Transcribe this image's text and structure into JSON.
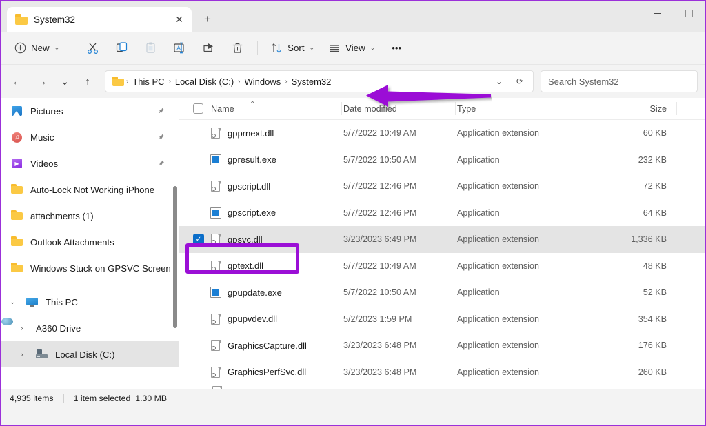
{
  "window": {
    "controls": {
      "minimize": "—",
      "maximize": "□"
    }
  },
  "tabbar": {
    "active_tab": "System32",
    "close_label": "✕",
    "new_tab_label": "+"
  },
  "toolbar": {
    "new_label": "New",
    "new_chevron": "⌄",
    "sort_label": "Sort",
    "sort_chevron": "⌄",
    "view_label": "View",
    "view_chevron": "⌄",
    "more_label": "•••"
  },
  "addressbar": {
    "back": "←",
    "forward": "→",
    "recent_chevron": "⌄",
    "up": "↑",
    "crumbs": [
      "This PC",
      "Local Disk (C:)",
      "Windows",
      "System32"
    ],
    "separator": "›",
    "dropdown_chevron": "⌄",
    "refresh": "⟳",
    "search_placeholder": "Search System32"
  },
  "sidebar": {
    "items": [
      {
        "label": "Pictures",
        "icon": "pictures-icon",
        "pinned": true,
        "indent": 1
      },
      {
        "label": "Music",
        "icon": "music-icon",
        "pinned": true,
        "indent": 1
      },
      {
        "label": "Videos",
        "icon": "videos-icon",
        "pinned": true,
        "indent": 1
      },
      {
        "label": "Auto-Lock Not Working iPhone",
        "icon": "folder-icon",
        "pinned": false,
        "indent": 1
      },
      {
        "label": "attachments (1)",
        "icon": "folder-icon",
        "pinned": false,
        "indent": 1
      },
      {
        "label": "Outlook Attachments",
        "icon": "folder-icon",
        "pinned": false,
        "indent": 1
      },
      {
        "label": "Windows Stuck on GPSVC Screen",
        "icon": "folder-icon",
        "pinned": false,
        "indent": 1
      }
    ],
    "tree": [
      {
        "label": "This PC",
        "icon": "pc-icon",
        "expander": "⌄",
        "selected": false
      },
      {
        "label": "A360 Drive",
        "icon": "drive-icon",
        "expander": "›",
        "selected": false
      },
      {
        "label": "Local Disk (C:)",
        "icon": "disk-icon",
        "expander": "›",
        "selected": true
      }
    ],
    "pin_glyph": "📌"
  },
  "filelist": {
    "columns": [
      "Name",
      "Date modified",
      "Type",
      "Size"
    ],
    "sort_caret": "⌃",
    "check_glyph": "✓",
    "rows": [
      {
        "name": "gpprnext.dll",
        "date": "5/7/2022 10:49 AM",
        "type": "Application extension",
        "size": "60 KB",
        "icon": "dll-file-icon",
        "selected": false
      },
      {
        "name": "gpresult.exe",
        "date": "5/7/2022 10:50 AM",
        "type": "Application",
        "size": "232 KB",
        "icon": "exe-file-icon",
        "selected": false
      },
      {
        "name": "gpscript.dll",
        "date": "5/7/2022 12:46 PM",
        "type": "Application extension",
        "size": "72 KB",
        "icon": "dll-file-icon",
        "selected": false
      },
      {
        "name": "gpscript.exe",
        "date": "5/7/2022 12:46 PM",
        "type": "Application",
        "size": "64 KB",
        "icon": "exe-file-icon",
        "selected": false
      },
      {
        "name": "gpsvc.dll",
        "date": "3/23/2023 6:49 PM",
        "type": "Application extension",
        "size": "1,336 KB",
        "icon": "dll-file-icon",
        "selected": true
      },
      {
        "name": "gptext.dll",
        "date": "5/7/2022 10:49 AM",
        "type": "Application extension",
        "size": "48 KB",
        "icon": "dll-file-icon",
        "selected": false
      },
      {
        "name": "gpupdate.exe",
        "date": "5/7/2022 10:50 AM",
        "type": "Application",
        "size": "52 KB",
        "icon": "exe-file-icon",
        "selected": false
      },
      {
        "name": "gpupvdev.dll",
        "date": "5/2/2023 1:59 PM",
        "type": "Application extension",
        "size": "354 KB",
        "icon": "dll-file-icon",
        "selected": false
      },
      {
        "name": "GraphicsCapture.dll",
        "date": "3/23/2023 6:48 PM",
        "type": "Application extension",
        "size": "176 KB",
        "icon": "dll-file-icon",
        "selected": false
      },
      {
        "name": "GraphicsPerfSvc.dll",
        "date": "3/23/2023 6:48 PM",
        "type": "Application extension",
        "size": "260 KB",
        "icon": "dll-file-icon",
        "selected": false
      }
    ]
  },
  "statusbar": {
    "item_count": "4,935 items",
    "selection": "1 item selected",
    "selection_size": "1.30 MB"
  },
  "annotations": {
    "highlight_color": "#9b0fd6",
    "arrow_color": "#9b0fd6",
    "arrow_target": "System32",
    "rect_target": "gpsvc.dll"
  }
}
